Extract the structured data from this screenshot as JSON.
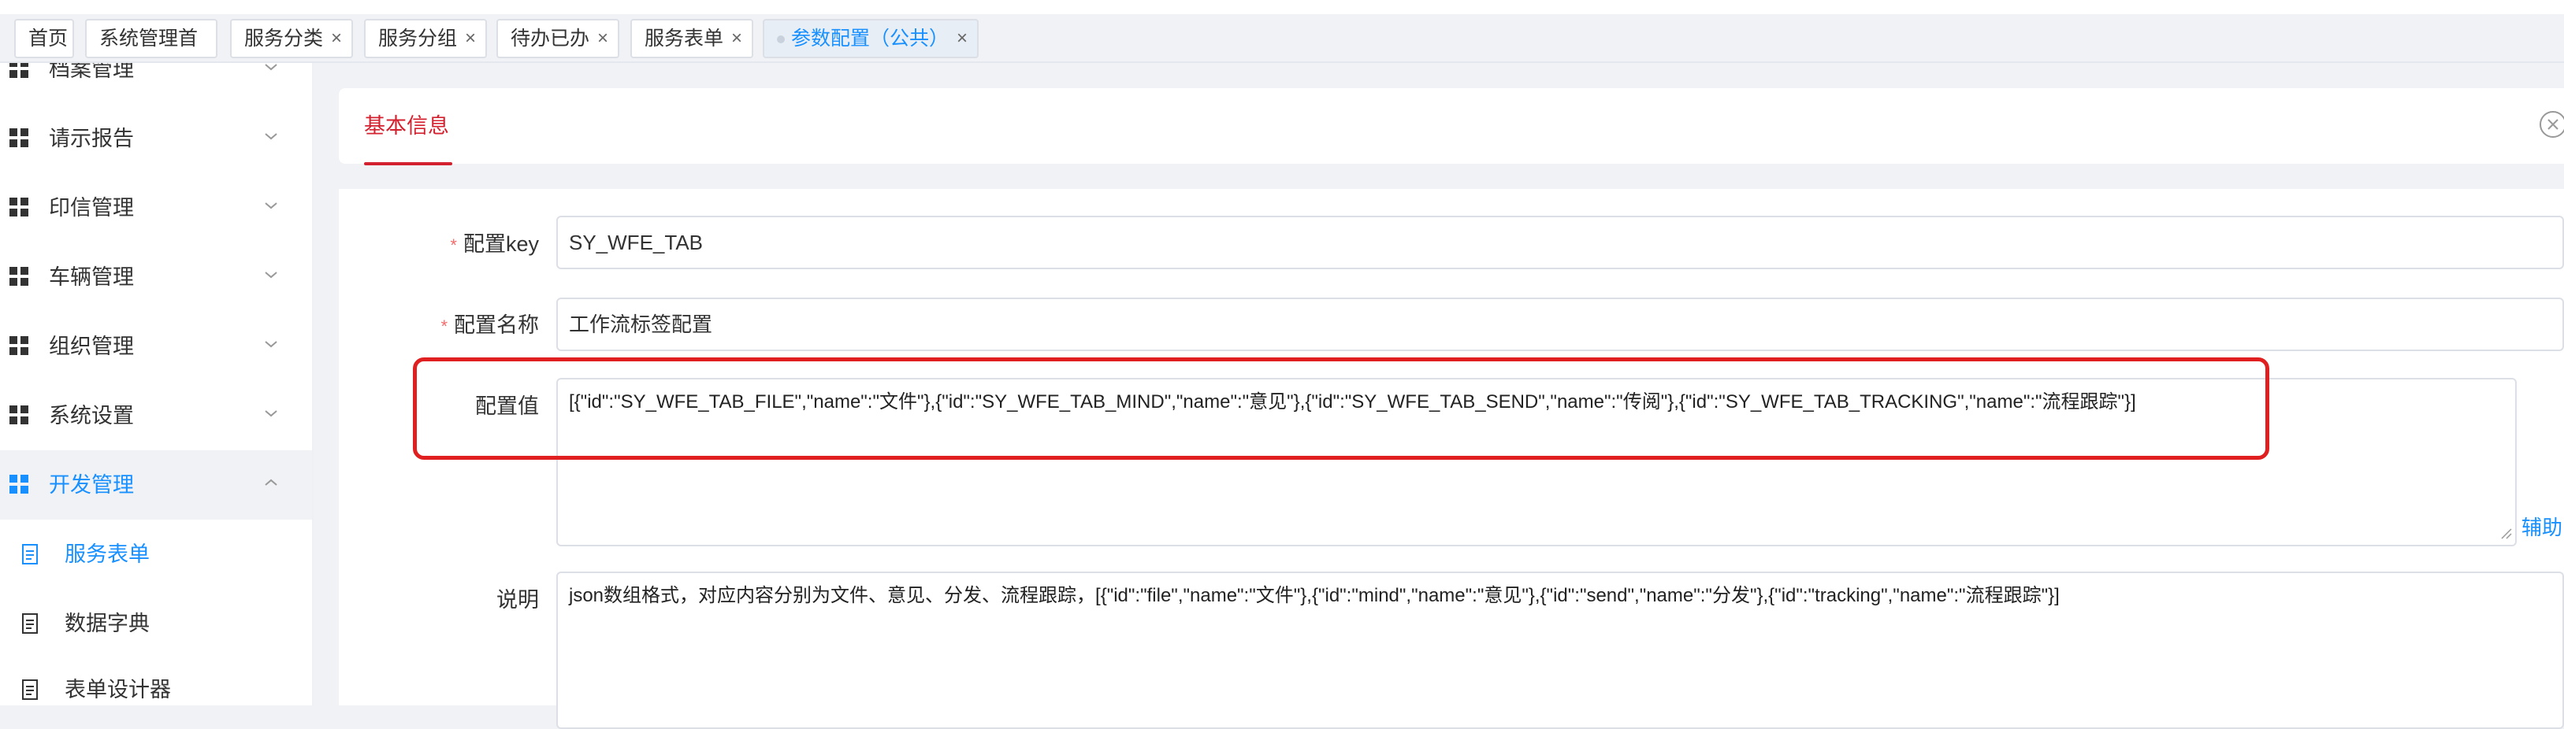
{
  "tabs": [
    {
      "label": "首页",
      "closable": false
    },
    {
      "label": "系统管理首页",
      "closable": false
    },
    {
      "label": "服务分类",
      "closable": true
    },
    {
      "label": "服务分组",
      "closable": true
    },
    {
      "label": "待办已办",
      "closable": true
    },
    {
      "label": "服务表单",
      "closable": true
    },
    {
      "label": "参数配置（公共）",
      "closable": true,
      "active": true
    }
  ],
  "tab_close_glyph": "×",
  "sidebar": {
    "menus": [
      {
        "label": "档案管理",
        "icon": "grid-icon",
        "expanded": false
      },
      {
        "label": "请示报告",
        "icon": "grid-icon",
        "expanded": false
      },
      {
        "label": "印信管理",
        "icon": "grid-icon",
        "expanded": false
      },
      {
        "label": "车辆管理",
        "icon": "grid-icon",
        "expanded": false
      },
      {
        "label": "组织管理",
        "icon": "grid-icon",
        "expanded": false
      },
      {
        "label": "系统设置",
        "icon": "grid-icon",
        "expanded": false
      },
      {
        "label": "开发管理",
        "icon": "grid-icon",
        "expanded": true,
        "active": true
      }
    ],
    "submenus": [
      {
        "label": "服务表单",
        "icon": "document-icon",
        "active": true
      },
      {
        "label": "数据字典",
        "icon": "document-icon",
        "active": false
      },
      {
        "label": "表单设计器",
        "icon": "document-icon",
        "active": false
      }
    ]
  },
  "card": {
    "title": "基本信息"
  },
  "form": {
    "config_key_label": "配置key",
    "config_key_value": "SY_WFE_TAB",
    "config_name_label": "配置名称",
    "config_name_value": "工作流标签配置",
    "config_value_label": "配置值",
    "config_value_text": "[{\"id\":\"SY_WFE_TAB_FILE\",\"name\":\"文件\"},{\"id\":\"SY_WFE_TAB_MIND\",\"name\":\"意见\"},{\"id\":\"SY_WFE_TAB_SEND\",\"name\":\"传阅\"},{\"id\":\"SY_WFE_TAB_TRACKING\",\"name\":\"流程跟踪\"}]",
    "helper_link": "辅助",
    "description_label": "说明",
    "description_text": "json数组格式，对应内容分别为文件、意见、分发、流程跟踪，[{\"id\":\"file\",\"name\":\"文件\"},{\"id\":\"mind\",\"name\":\"意见\"},{\"id\":\"send\",\"name\":\"分发\"},{\"id\":\"tracking\",\"name\":\"流程跟踪\"}]",
    "required_mark": "*"
  },
  "colors": {
    "accent": "#1890ff",
    "title_red": "#d4212f",
    "highlight": "#e02020"
  }
}
